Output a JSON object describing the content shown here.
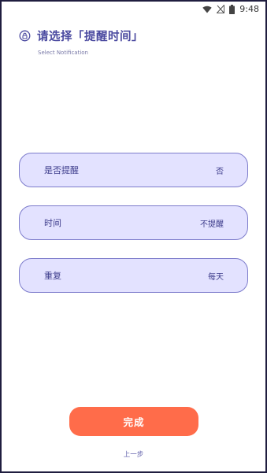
{
  "status_bar": {
    "time": "9:48",
    "icons": [
      "wifi-icon",
      "no-signal-icon",
      "battery-icon"
    ]
  },
  "header": {
    "icon": "lock-icon",
    "title": "请选择「提醒时间」",
    "subtitle": "Select Notification"
  },
  "options": [
    {
      "label": "是否提醒",
      "value": "否"
    },
    {
      "label": "时间",
      "value": "不提醒"
    },
    {
      "label": "重复",
      "value": "每天"
    }
  ],
  "actions": {
    "done_label": "完成",
    "prev_label": "上一步"
  },
  "colors": {
    "accent": "#4b4aa0",
    "option_bg": "#e3e2ff",
    "option_border": "#7c7bcb",
    "button": "#ff6c4a"
  }
}
